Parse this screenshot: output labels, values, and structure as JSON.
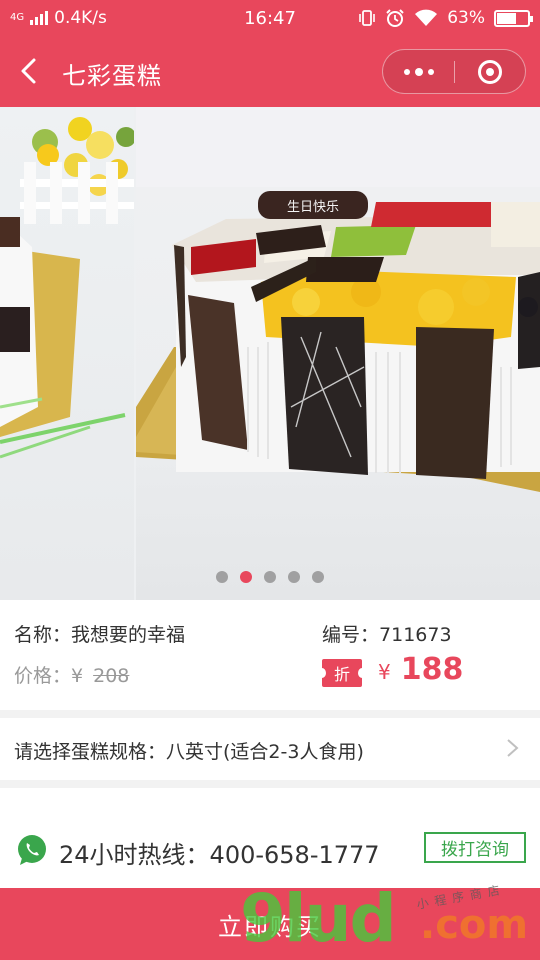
{
  "status_bar": {
    "network": "4G",
    "speed": "0.4K/s",
    "time": "16:47",
    "battery": "63%",
    "battery_level": 0.63
  },
  "nav": {
    "title": "七彩蛋糕"
  },
  "banner": {
    "slide_count": 5,
    "active_index": 1
  },
  "product": {
    "name_label": "名称：",
    "name": "我想要的幸福",
    "code_label": "编号：",
    "code": "711673",
    "orig_price_label": "价格：",
    "currency": "¥",
    "orig_price": "208",
    "discount_tag": "折",
    "price": "188",
    "cake_plaque": "生日快乐"
  },
  "spec": {
    "label": "请选择蛋糕规格：",
    "value": "八英寸(适合2-3人食用)"
  },
  "hotline": {
    "label": "24小时热线：",
    "number": "400-658-1777",
    "call_button": "拨打咨询"
  },
  "buy_button": "立即购买",
  "watermark": {
    "logo": "9lud",
    "domain": ".com",
    "tagline": "小程序商店"
  },
  "colors": {
    "brand": "#e8475c",
    "call_green": "#3aa64c"
  }
}
